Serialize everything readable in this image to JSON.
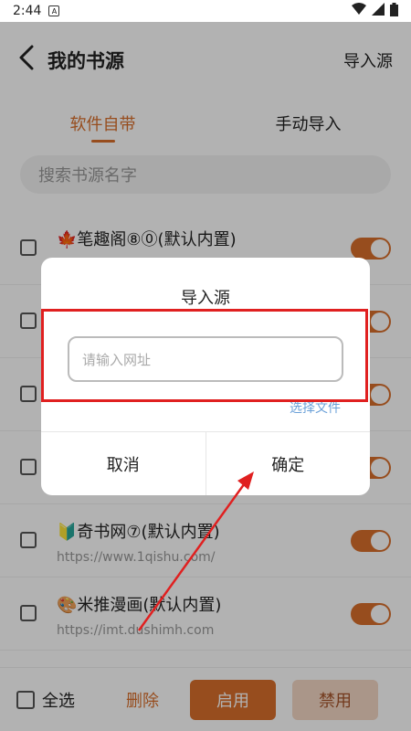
{
  "status": {
    "time": "2:44",
    "notif": "A"
  },
  "header": {
    "title": "我的书源",
    "action": "导入源"
  },
  "tabs": [
    {
      "label": "软件自带"
    },
    {
      "label": "手动导入"
    }
  ],
  "search": {
    "placeholder": "搜索书源名字"
  },
  "sources": [
    {
      "name": "🍁笔趣阁⑧⓪(默认内置)",
      "url": ""
    },
    {
      "name": "",
      "url": ""
    },
    {
      "name": "",
      "url": ""
    },
    {
      "name": "",
      "url": ""
    },
    {
      "name": "🔰奇书网⑦(默认内置)",
      "url": "https://www.1qishu.com/"
    },
    {
      "name": "🎨米推漫画(默认内置)",
      "url": "https://imt.dushimh.com"
    }
  ],
  "bottom": {
    "select_all": "全选",
    "delete": "删除",
    "enable": "启用",
    "disable": "禁用"
  },
  "dialog": {
    "title": "导入源",
    "input_placeholder": "请输入网址",
    "choose_file": "选择文件",
    "cancel": "取消",
    "confirm": "确定"
  },
  "colors": {
    "accent": "#d96f2c",
    "annotation": "#e02020",
    "link": "#6aa0d8"
  }
}
